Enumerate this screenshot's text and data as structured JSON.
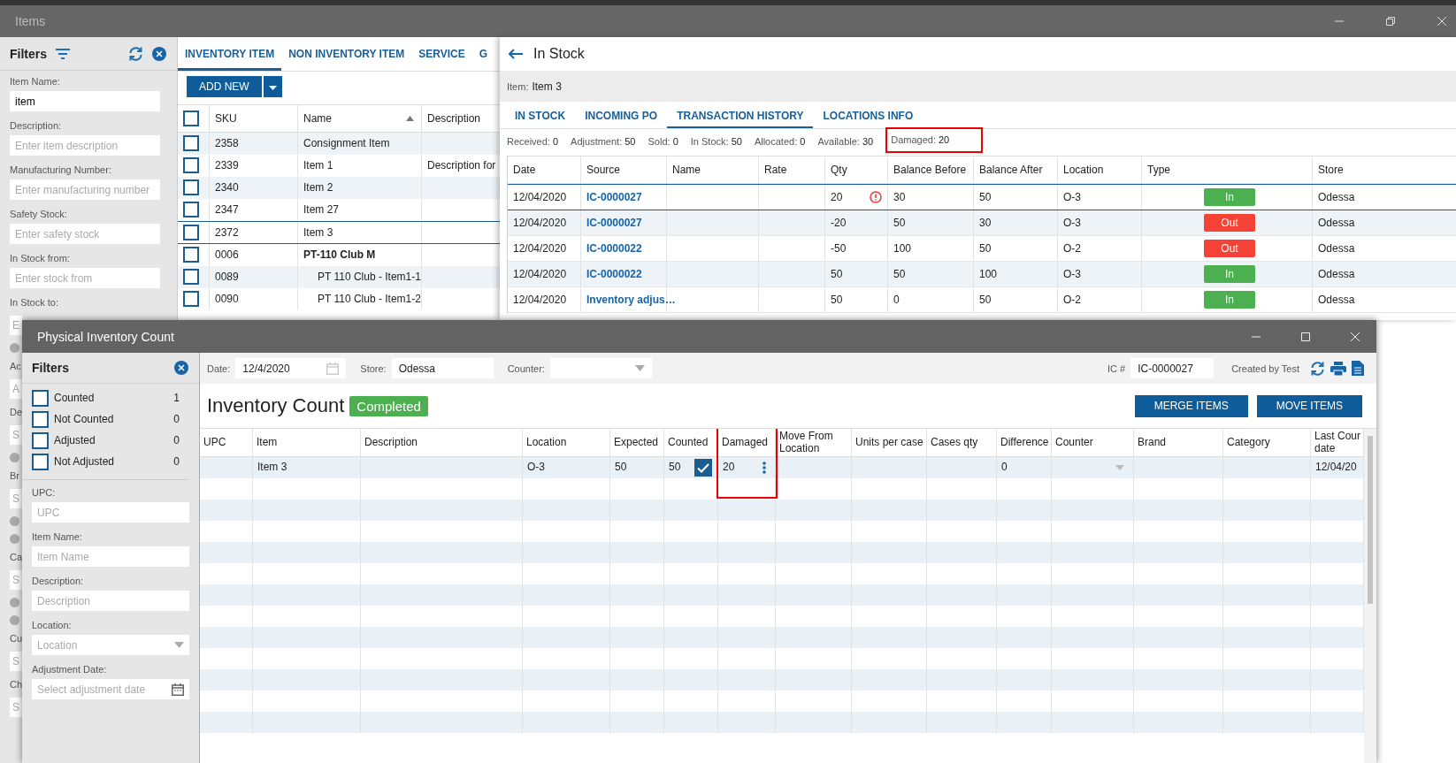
{
  "items_window": {
    "title": "Items",
    "filters": {
      "title": "Filters",
      "fields": [
        {
          "label": "Item Name:",
          "value": "item"
        },
        {
          "label": "Description:",
          "placeholder": "Enter item description"
        },
        {
          "label": "Manufacturing Number:",
          "placeholder": "Enter manufacturing number"
        },
        {
          "label": "Safety Stock:",
          "placeholder": "Enter safety stock"
        },
        {
          "label": "In Stock from:",
          "placeholder": "Enter stock from"
        }
      ],
      "covered": [
        {
          "kind": "label",
          "text": "In Stock to:"
        },
        {
          "kind": "field",
          "text": "E"
        },
        {
          "kind": "radio",
          "checked": false
        },
        {
          "kind": "label",
          "text": "Ac"
        },
        {
          "kind": "field",
          "text": "A"
        },
        {
          "kind": "label",
          "text": "De"
        },
        {
          "kind": "field",
          "text": "S"
        },
        {
          "kind": "radio",
          "checked": false
        },
        {
          "kind": "label",
          "text": "Br"
        },
        {
          "kind": "field",
          "text": "S"
        },
        {
          "kind": "radio",
          "checked": false
        },
        {
          "kind": "radio",
          "checked": false
        },
        {
          "kind": "label",
          "text": "Ca"
        },
        {
          "kind": "field",
          "text": "S"
        },
        {
          "kind": "radio",
          "checked": false
        },
        {
          "kind": "radio",
          "checked": false
        },
        {
          "kind": "label",
          "text": "Cu"
        },
        {
          "kind": "field",
          "text": "S"
        },
        {
          "kind": "label",
          "text": "Ch"
        },
        {
          "kind": "field",
          "text": "S"
        }
      ]
    },
    "tabs": [
      {
        "label": "INVENTORY ITEM",
        "selected": true
      },
      {
        "label": "NON INVENTORY ITEM",
        "selected": false
      },
      {
        "label": "SERVICE",
        "selected": false
      },
      {
        "label": "G",
        "selected": false
      }
    ],
    "add_button": "ADD NEW",
    "list": {
      "select_all_checked": false,
      "columns": [
        {
          "label": "SKU",
          "sorted": false
        },
        {
          "label": "Name",
          "sorted": true
        },
        {
          "label": "Description",
          "sorted": false
        }
      ],
      "rows": [
        {
          "sku": "2358",
          "name": "Consignment Item",
          "kind": "item",
          "selected": false
        },
        {
          "sku": "2339",
          "name": "Item 1",
          "description": "Description for",
          "kind": "item",
          "selected": false
        },
        {
          "sku": "2340",
          "name": "Item 2",
          "kind": "item",
          "selected": false
        },
        {
          "sku": "2347",
          "name": "Item 27",
          "kind": "item",
          "selected": false
        },
        {
          "sku": "2372",
          "name": "Item 3",
          "kind": "item",
          "selected": true
        },
        {
          "sku": "0006",
          "name": "PT-110 Club M",
          "kind": "group",
          "selected": false
        },
        {
          "sku": "0089",
          "name": "PT 110 Club - Item1-1",
          "kind": "child",
          "selected": false
        },
        {
          "sku": "0090",
          "name": "PT 110 Club - Item1-2",
          "kind": "child",
          "selected": false
        }
      ]
    },
    "in_stock": {
      "title": "In Stock",
      "item_label": "Item:",
      "item_value": "Item 3",
      "tabs": [
        {
          "label": "IN STOCK",
          "selected": false
        },
        {
          "label": "INCOMING PO",
          "selected": false
        },
        {
          "label": "TRANSACTION HISTORY",
          "selected": true
        },
        {
          "label": "LOCATIONS INFO",
          "selected": false
        }
      ],
      "summary": [
        {
          "label": "Received:",
          "value": "0",
          "highlighted": false
        },
        {
          "label": "Adjustment:",
          "value": "50",
          "highlighted": false
        },
        {
          "label": "Sold:",
          "value": "0",
          "highlighted": false
        },
        {
          "label": "In Stock:",
          "value": "50",
          "highlighted": false
        },
        {
          "label": "Allocated:",
          "value": "0",
          "highlighted": false
        },
        {
          "label": "Available:",
          "value": "30",
          "highlighted": false
        },
        {
          "label": "Damaged:",
          "value": "20",
          "highlighted": true
        }
      ],
      "columns": [
        "Date",
        "Source",
        "Name",
        "Rate",
        "Qty",
        "Balance Before",
        "Balance After",
        "Location",
        "Type",
        "Store"
      ],
      "rows": [
        {
          "date": "12/04/2020",
          "source": "IC-0000027",
          "qty": "20",
          "warning": true,
          "before": "30",
          "after": "50",
          "location": "O-3",
          "type": "In",
          "kind": "in",
          "store": "Odessa",
          "selected": true
        },
        {
          "date": "12/04/2020",
          "source": "IC-0000027",
          "qty": "-20",
          "warning": false,
          "before": "50",
          "after": "30",
          "location": "O-3",
          "type": "Out",
          "kind": "out",
          "store": "Odessa",
          "selected": false
        },
        {
          "date": "12/04/2020",
          "source": "IC-0000022",
          "qty": "-50",
          "warning": false,
          "before": "100",
          "after": "50",
          "location": "O-2",
          "type": "Out",
          "kind": "out",
          "store": "Odessa",
          "selected": false
        },
        {
          "date": "12/04/2020",
          "source": "IC-0000022",
          "qty": "50",
          "warning": false,
          "before": "50",
          "after": "100",
          "location": "O-3",
          "type": "In",
          "kind": "in",
          "store": "Odessa",
          "selected": false
        },
        {
          "date": "12/04/2020",
          "source": "Inventory adjus…",
          "qty": "50",
          "warning": false,
          "before": "0",
          "after": "50",
          "location": "O-2",
          "type": "In",
          "kind": "in",
          "store": "Odessa",
          "selected": false
        }
      ]
    }
  },
  "count_window": {
    "title": "Physical Inventory Count",
    "filters": {
      "title": "Filters",
      "checks": [
        {
          "label": "Counted",
          "count": "1",
          "checked": false
        },
        {
          "label": "Not Counted",
          "count": "0",
          "checked": false
        },
        {
          "label": "Adjusted",
          "count": "0",
          "checked": false
        },
        {
          "label": "Not Adjusted",
          "count": "0",
          "checked": false
        }
      ],
      "fields": [
        {
          "label": "UPC:",
          "placeholder": "UPC",
          "kind": "text"
        },
        {
          "label": "Item Name:",
          "placeholder": "Item Name",
          "kind": "text"
        },
        {
          "label": "Description:",
          "placeholder": "Description",
          "kind": "text"
        },
        {
          "label": "Location:",
          "placeholder": "Location",
          "kind": "select"
        },
        {
          "label": "Adjustment Date:",
          "placeholder": "Select adjustment date",
          "kind": "date"
        }
      ]
    },
    "toolbar": {
      "date_label": "Date:",
      "date": "12/4/2020",
      "store_label": "Store:",
      "store": "Odessa",
      "counter_label": "Counter:",
      "ic_label": "IC #",
      "ic": "IC-0000027",
      "created": "Created by Test"
    },
    "heading": "Inventory Count",
    "status": "Completed",
    "buttons": [
      "MERGE ITEMS",
      "MOVE ITEMS"
    ],
    "grid": {
      "columns": [
        {
          "label": "UPC",
          "highlighted": false
        },
        {
          "label": "Item",
          "highlighted": false
        },
        {
          "label": "Description",
          "highlighted": false
        },
        {
          "label": "Location",
          "highlighted": false
        },
        {
          "label": "Expected",
          "highlighted": false
        },
        {
          "label": "Counted",
          "highlighted": false
        },
        {
          "label": "Damaged",
          "highlighted": true
        },
        {
          "label": "Move From Location",
          "highlighted": false
        },
        {
          "label": "Units per case",
          "highlighted": false
        },
        {
          "label": "Cases qty",
          "highlighted": false
        },
        {
          "label": "Difference",
          "highlighted": false
        },
        {
          "label": "Counter",
          "highlighted": false
        },
        {
          "label": "Brand",
          "highlighted": false
        },
        {
          "label": "Category",
          "highlighted": false
        },
        {
          "label": "Last Cour date",
          "highlighted": false
        }
      ],
      "rows": [
        {
          "cells": [
            {
              "kind": "empty"
            },
            {
              "kind": "text",
              "text": "Item 3"
            },
            {
              "kind": "empty"
            },
            {
              "kind": "text",
              "text": "O-3"
            },
            {
              "kind": "text",
              "text": "50"
            },
            {
              "kind": "check",
              "text": "50",
              "checked": true
            },
            {
              "kind": "menu",
              "text": "20"
            },
            {
              "kind": "empty"
            },
            {
              "kind": "empty"
            },
            {
              "kind": "empty"
            },
            {
              "kind": "text",
              "text": "0"
            },
            {
              "kind": "select"
            },
            {
              "kind": "empty"
            },
            {
              "kind": "empty"
            },
            {
              "kind": "text",
              "text": "12/04/20"
            }
          ]
        }
      ]
    }
  }
}
